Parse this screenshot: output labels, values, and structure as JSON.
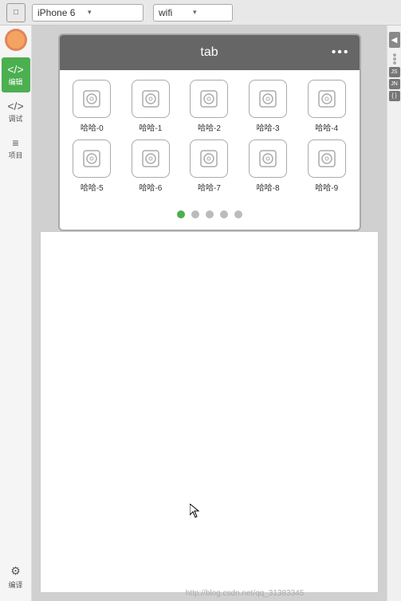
{
  "topbar": {
    "device_label": "iPhone 6",
    "device_arrow": "▾",
    "wifi_label": "wifi",
    "wifi_arrow": "▾"
  },
  "sidebar": {
    "items": [
      {
        "id": "code",
        "icon": "</>",
        "label": "编辑",
        "active": true
      },
      {
        "id": "debug",
        "icon": "</>",
        "label": "调试",
        "active": false
      },
      {
        "id": "project",
        "icon": "≡",
        "label": "项目",
        "active": false
      }
    ],
    "bottom_items": [
      {
        "id": "compile",
        "icon": "⚙",
        "label": "编译"
      }
    ]
  },
  "phone": {
    "tab_title": "tab",
    "tab_dots": "•••",
    "grid_items": [
      "哈哈-0",
      "哈哈-1",
      "哈哈-2",
      "哈哈-3",
      "哈哈-4",
      "哈哈-5",
      "哈哈-6",
      "哈哈-7",
      "哈哈-8",
      "哈哈-9"
    ],
    "pagination": {
      "total": 5,
      "active": 0
    }
  },
  "right_panel": {
    "arrow": "◀",
    "tags": [
      "JS",
      "JN",
      "{ }"
    ]
  },
  "watermark": "http://blog.csdn.net/qq_31383345"
}
